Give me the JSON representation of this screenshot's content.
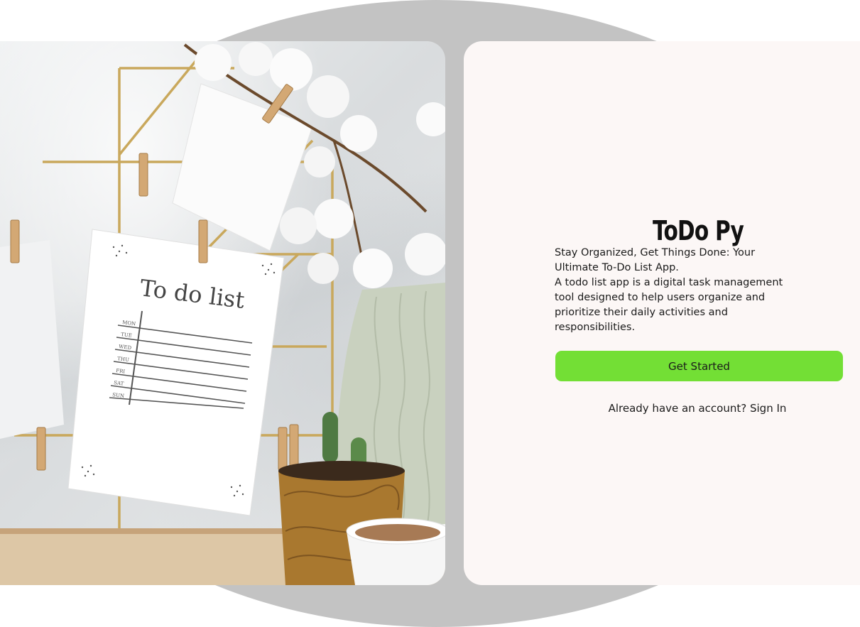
{
  "app": {
    "title": "ToDo Py"
  },
  "hero": {
    "tagline": "Stay Organized, Get Things Done: Your Ultimate To-Do List App.",
    "description": "A todo list app is a digital task management tool designed to help users organize and prioritize their daily activities and responsibilities."
  },
  "actions": {
    "get_started_label": "Get Started",
    "signin_prompt": "Already have an account?",
    "signin_link": "Sign In"
  },
  "illustration": {
    "note_title": "To do list",
    "days": [
      "MON",
      "TUE",
      "WED",
      "THU",
      "FRI",
      "SAT",
      "SUN"
    ]
  },
  "colors": {
    "accent": "#73df35",
    "card_background": "#fcf7f6",
    "page_background": "#c3c3c3"
  }
}
